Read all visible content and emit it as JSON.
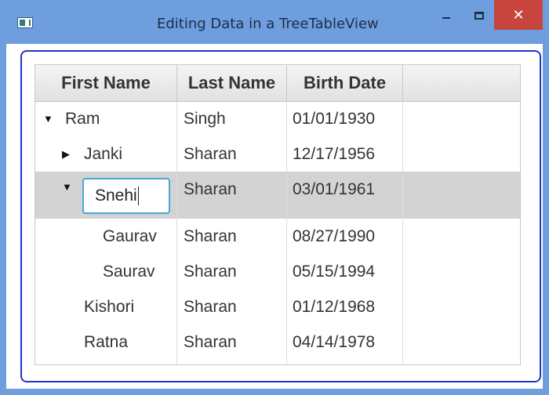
{
  "window": {
    "title": "Editing Data in a TreeTableView",
    "minimize_icon": "minimize-icon",
    "maximize_icon": "maximize-icon",
    "close_label": "✕"
  },
  "table": {
    "columns": [
      "First Name",
      "Last Name",
      "Birth Date",
      ""
    ],
    "rows": [
      {
        "first": "Ram",
        "last": "Singh",
        "birth": "01/01/1930",
        "depth": 0,
        "disclosure": "▼",
        "selected": false,
        "editing": false
      },
      {
        "first": "Janki",
        "last": "Sharan",
        "birth": "12/17/1956",
        "depth": 1,
        "disclosure": "▶",
        "selected": false,
        "editing": false
      },
      {
        "first": "Snehi",
        "last": "Sharan",
        "birth": "03/01/1961",
        "depth": 1,
        "disclosure": "▼",
        "selected": true,
        "editing": true
      },
      {
        "first": "Gaurav",
        "last": "Sharan",
        "birth": "08/27/1990",
        "depth": 2,
        "disclosure": "",
        "selected": false,
        "editing": false
      },
      {
        "first": "Saurav",
        "last": "Sharan",
        "birth": "05/15/1994",
        "depth": 2,
        "disclosure": "",
        "selected": false,
        "editing": false
      },
      {
        "first": "Kishori",
        "last": "Sharan",
        "birth": "01/12/1968",
        "depth": 1,
        "disclosure": "",
        "selected": false,
        "editing": false
      },
      {
        "first": "Ratna",
        "last": "Sharan",
        "birth": "04/14/1978",
        "depth": 1,
        "disclosure": "",
        "selected": false,
        "editing": false
      }
    ]
  },
  "colors": {
    "titlebar": "#6f9ede",
    "close_button": "#c7443f",
    "selection": "#d3d3d3",
    "edit_border": "#48a7d8",
    "focus_frame": "#2233cc"
  }
}
